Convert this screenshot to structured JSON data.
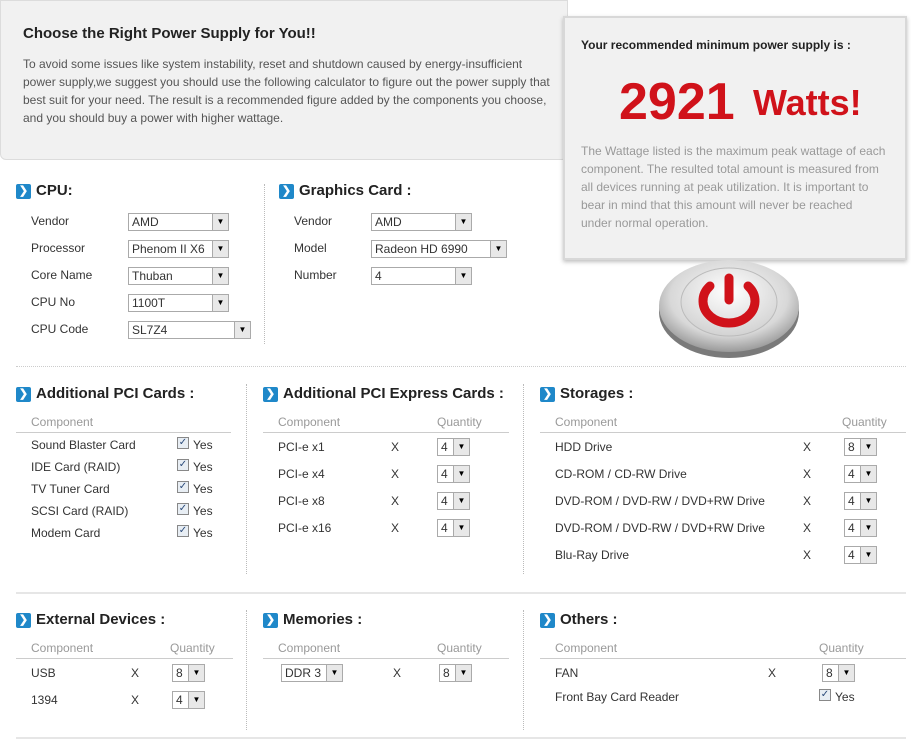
{
  "intro": {
    "title": "Choose the Right Power Supply for You!!",
    "body": "To avoid some issues like system instability, reset and shutdown caused by energy-insufficient power supply,we suggest you should use the following calculator to figure out the power supply that best suit for your need. The result is a recommended figure added by the components you choose, and you should buy a power with higher wattage."
  },
  "result": {
    "label": "Your recommended minimum power supply is :",
    "watts": "2921",
    "unit": "Watts!",
    "note": "The Wattage listed is the maximum peak wattage of each component. The resulted total amount is measured from all devices running at peak utilization. It is important to bear in mind that this amount will never be reached under normal operation.",
    "accent_color": "#d0121a"
  },
  "common": {
    "component": "Component",
    "quantity": "Quantity",
    "x": "X",
    "yes": "Yes",
    "section_icon": "chevron-right-icon"
  },
  "cpu": {
    "title": "CPU:",
    "rows": [
      {
        "label": "Vendor",
        "value": "AMD"
      },
      {
        "label": "Processor",
        "value": "Phenom II X6"
      },
      {
        "label": "Core Name",
        "value": "Thuban"
      },
      {
        "label": "CPU No",
        "value": "1100T"
      },
      {
        "label": "CPU Code",
        "value": "SL7Z4"
      }
    ]
  },
  "gpu": {
    "title": "Graphics Card :",
    "rows": [
      {
        "label": "Vendor",
        "value": "AMD"
      },
      {
        "label": "Model",
        "value": "Radeon HD 6990"
      },
      {
        "label": "Number",
        "value": "4"
      }
    ]
  },
  "pci": {
    "title": "Additional PCI Cards :",
    "items": [
      "Sound Blaster Card",
      "IDE Card (RAID)",
      "TV Tuner Card",
      "SCSI Card (RAID)",
      "Modem Card"
    ]
  },
  "pcie": {
    "title": "Additional PCI Express Cards :",
    "items": [
      {
        "label": "PCI-e x1",
        "qty": "4"
      },
      {
        "label": "PCI-e x4",
        "qty": "4"
      },
      {
        "label": "PCI-e x8",
        "qty": "4"
      },
      {
        "label": "PCI-e x16",
        "qty": "4"
      }
    ]
  },
  "storage": {
    "title": "Storages :",
    "items": [
      {
        "label": "HDD Drive",
        "qty": "8"
      },
      {
        "label": "CD-ROM / CD-RW Drive",
        "qty": "4"
      },
      {
        "label": "DVD-ROM / DVD-RW / DVD+RW Drive",
        "qty": "4"
      },
      {
        "label": "DVD-ROM / DVD-RW / DVD+RW Drive",
        "qty": "4"
      },
      {
        "label": "Blu-Ray Drive",
        "qty": "4"
      }
    ]
  },
  "external": {
    "title": "External Devices :",
    "items": [
      {
        "label": "USB",
        "qty": "8"
      },
      {
        "label": "1394",
        "qty": "4"
      }
    ]
  },
  "memory": {
    "title": "Memories :",
    "type": "DDR 3",
    "qty": "8"
  },
  "others": {
    "title": "Others :",
    "fan_label": "FAN",
    "fan_qty": "8",
    "reader_label": "Front Bay Card Reader"
  }
}
